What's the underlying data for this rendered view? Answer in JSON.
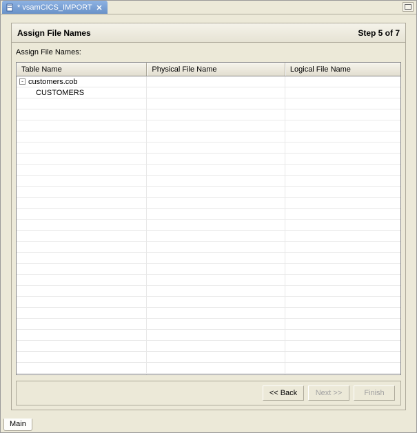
{
  "tabs": {
    "top": {
      "label": "* vsamCICS_IMPORT"
    },
    "bottom": {
      "label": "Main"
    }
  },
  "wizard": {
    "title": "Assign File Names",
    "step_label": "Step 5 of 7",
    "field_label": "Assign File Names:"
  },
  "grid": {
    "columns": [
      "Table Name",
      "Physical File Name",
      "Logical File Name"
    ],
    "rows": [
      {
        "level": 0,
        "expand": "-",
        "c0": "customers.cob",
        "c1": "",
        "c2": ""
      },
      {
        "level": 1,
        "expand": "",
        "c0": "CUSTOMERS",
        "c1": "",
        "c2": ""
      }
    ]
  },
  "buttons": {
    "back": "<< Back",
    "next": "Next >>",
    "finish": "Finish"
  }
}
